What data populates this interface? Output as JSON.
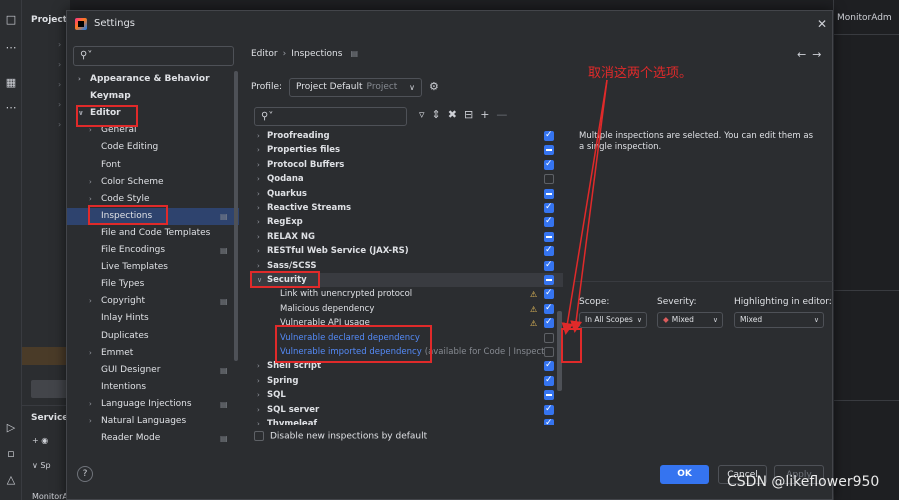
{
  "ide": {
    "project_title": "Project",
    "services_title": "Services",
    "service_app": "MonitorAdminApplication",
    "right_tab": "MonitorAdm"
  },
  "dialog": {
    "title": "Settings",
    "search_placeholder": "",
    "nav": [
      {
        "label": "Appearance & Behavior",
        "level": 0,
        "arrow": "›",
        "bold": true
      },
      {
        "label": "Keymap",
        "level": 0,
        "arrow": "",
        "bold": true
      },
      {
        "label": "Editor",
        "level": 0,
        "arrow": "∨",
        "bold": true
      },
      {
        "label": "General",
        "level": 1,
        "arrow": "›"
      },
      {
        "label": "Code Editing",
        "level": 1,
        "arrow": ""
      },
      {
        "label": "Font",
        "level": 1,
        "arrow": ""
      },
      {
        "label": "Color Scheme",
        "level": 1,
        "arrow": "›"
      },
      {
        "label": "Code Style",
        "level": 1,
        "arrow": "›"
      },
      {
        "label": "Inspections",
        "level": 1,
        "arrow": "",
        "pin": true,
        "selected": true
      },
      {
        "label": "File and Code Templates",
        "level": 1,
        "arrow": ""
      },
      {
        "label": "File Encodings",
        "level": 1,
        "arrow": "",
        "pin": true
      },
      {
        "label": "Live Templates",
        "level": 1,
        "arrow": ""
      },
      {
        "label": "File Types",
        "level": 1,
        "arrow": ""
      },
      {
        "label": "Copyright",
        "level": 1,
        "arrow": "›",
        "pin": true
      },
      {
        "label": "Inlay Hints",
        "level": 1,
        "arrow": ""
      },
      {
        "label": "Duplicates",
        "level": 1,
        "arrow": ""
      },
      {
        "label": "Emmet",
        "level": 1,
        "arrow": "›"
      },
      {
        "label": "GUI Designer",
        "level": 1,
        "arrow": "",
        "pin": true
      },
      {
        "label": "Intentions",
        "level": 1,
        "arrow": ""
      },
      {
        "label": "Language Injections",
        "level": 1,
        "arrow": "›",
        "pin": true
      },
      {
        "label": "Natural Languages",
        "level": 1,
        "arrow": "›"
      },
      {
        "label": "Reader Mode",
        "level": 1,
        "arrow": "",
        "pin": true
      }
    ],
    "breadcrumb": {
      "parent": "Editor",
      "current": "Inspections"
    },
    "profile": {
      "label": "Profile:",
      "value": "Project Default",
      "scope": "Project"
    },
    "inspections": [
      {
        "label": "Proofreading",
        "state": "on"
      },
      {
        "label": "Properties files",
        "state": "mixed"
      },
      {
        "label": "Protocol Buffers",
        "state": "on"
      },
      {
        "label": "Qodana",
        "state": "off"
      },
      {
        "label": "Quarkus",
        "state": "mixed"
      },
      {
        "label": "Reactive Streams",
        "state": "on"
      },
      {
        "label": "RegExp",
        "state": "on"
      },
      {
        "label": "RELAX NG",
        "state": "mixed"
      },
      {
        "label": "RESTful Web Service (JAX-RS)",
        "state": "on"
      },
      {
        "label": "Sass/SCSS",
        "state": "on"
      },
      {
        "label": "Security",
        "state": "mixed",
        "expanded": true,
        "selected": true
      },
      {
        "label": "Link with unencrypted protocol",
        "state": "on",
        "child": true,
        "warn": true
      },
      {
        "label": "Malicious dependency",
        "state": "on",
        "child": true,
        "warn": true
      },
      {
        "label": "Vulnerable API usage",
        "state": "on",
        "child": true,
        "warn": true
      },
      {
        "label": "Vulnerable declared dependency",
        "state": "off",
        "child": true,
        "link": true
      },
      {
        "label": "Vulnerable imported dependency",
        "note": "(available for Code | Inspect",
        "state": "off",
        "child": true,
        "link": true
      },
      {
        "label": "Shell script",
        "state": "on"
      },
      {
        "label": "Spring",
        "state": "on"
      },
      {
        "label": "SQL",
        "state": "mixed"
      },
      {
        "label": "SQL server",
        "state": "on"
      },
      {
        "label": "Thymeleaf",
        "state": "on"
      }
    ],
    "description": "Multiple inspections are selected. You can edit them as a single inspection.",
    "options": {
      "scope_label": "Scope:",
      "scope_value": "In All Scopes",
      "severity_label": "Severity:",
      "severity_value": "Mixed",
      "highlight_label": "Highlighting in editor:",
      "highlight_value": "Mixed"
    },
    "disable_new": "Disable new inspections by default",
    "buttons": {
      "ok": "OK",
      "cancel": "Cancel",
      "apply": "Apply"
    }
  },
  "annotation": "取消这两个选项。",
  "watermark": "CSDN @likeflower950"
}
